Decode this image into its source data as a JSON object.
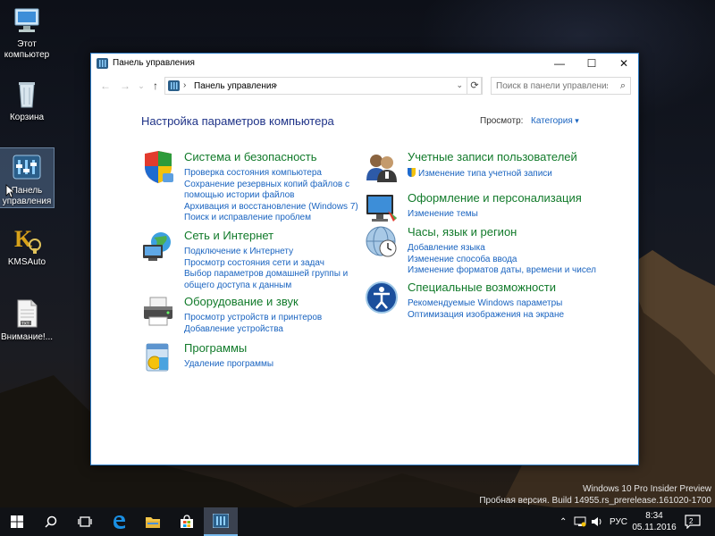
{
  "desktop": {
    "icons": [
      {
        "label": "Этот компьютер",
        "icon": "computer-icon"
      },
      {
        "label": "Корзина",
        "icon": "recycle-bin-icon"
      },
      {
        "label": "Панель управления",
        "icon": "control-panel-icon"
      },
      {
        "label": "KMSAuto",
        "icon": "kmsauto-icon"
      },
      {
        "label": "Внимание!...",
        "icon": "text-file-icon"
      }
    ],
    "watermark": {
      "line1": "Windows 10 Pro Insider Preview",
      "line2": "Пробная версия. Build 14955.rs_prerelease.161020-1700"
    }
  },
  "window": {
    "title": "Панель управления",
    "controls": {
      "minimize": "—",
      "maximize": "☐",
      "close": "✕"
    },
    "address": {
      "crumb": "Панель управления",
      "separator": "›"
    },
    "search": {
      "placeholder": "Поиск в панели управления"
    },
    "page_title": "Настройка параметров компьютера",
    "view_by_label": "Просмотр:",
    "view_by_value": "Категория",
    "left_categories": [
      {
        "title": "Система и безопасность",
        "icon": "shield-icon",
        "links": [
          "Проверка состояния компьютера",
          "Сохранение резервных копий файлов с",
          "помощью истории файлов",
          "Архивация и восстановление (Windows 7)",
          "Поиск и исправление проблем"
        ]
      },
      {
        "title": "Сеть и Интернет",
        "icon": "network-icon",
        "links": [
          "Подключение к Интернету",
          "Просмотр состояния сети и задач",
          "Выбор параметров домашней группы и",
          "общего доступа к данным"
        ]
      },
      {
        "title": "Оборудование и звук",
        "icon": "printer-icon",
        "links": [
          "Просмотр устройств и принтеров",
          "Добавление устройства"
        ]
      },
      {
        "title": "Программы",
        "icon": "programs-icon",
        "links": [
          "Удаление программы"
        ]
      }
    ],
    "right_categories": [
      {
        "title": "Учетные записи пользователей",
        "icon": "users-icon",
        "links": [
          "Изменение типа учетной записи"
        ]
      },
      {
        "title": "Оформление и персонализация",
        "icon": "monitor-icon",
        "links": [
          "Изменение темы"
        ]
      },
      {
        "title": "Часы, язык и регион",
        "icon": "clock-globe-icon",
        "links": [
          "Добавление языка",
          "Изменение способа ввода",
          "Изменение форматов даты, времени и чисел"
        ]
      },
      {
        "title": "Специальные возможности",
        "icon": "accessibility-icon",
        "links": [
          "Рекомендуемые Windows параметры",
          "Оптимизация изображения на экране"
        ]
      }
    ]
  },
  "taskbar": {
    "language": "РУС",
    "time": "8:34",
    "date": "05.11.2016",
    "notifications": "2",
    "colors": {
      "accent": "#76b9ed",
      "bar": "#101216"
    }
  }
}
